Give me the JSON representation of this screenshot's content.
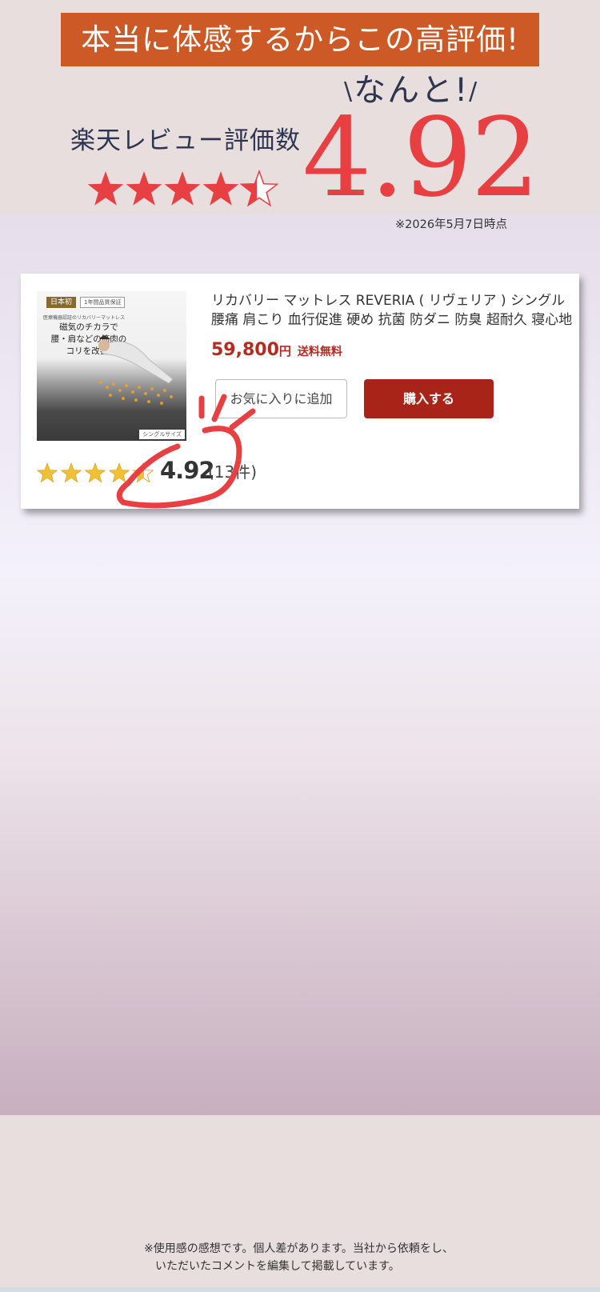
{
  "banner": {
    "text": "本当に体感するからこの高評価!"
  },
  "headline": {
    "exclaim": "なんと!",
    "review_label": "楽天レビュー評価数",
    "score": "4.92",
    "date_note": "※2026年5月7日時点"
  },
  "product": {
    "name_line1": "リカバリー マットレス REVERIA ( リヴェリア ) シングル",
    "name_line2": "腰痛 肩こり 血行促進 硬め 抗菌 防ダニ 防臭 超耐久 寝心地",
    "price": "59,800",
    "price_unit": "円",
    "shipping": "送料無料",
    "favorite_label": "お気に入りに追加",
    "buy_label": "購入する",
    "rating": 4.92,
    "rating_text": "4.92",
    "review_count": "(13件)",
    "image": {
      "badge": "日本初",
      "badge2": "1年間品質保証",
      "subcopy": "医療機器認証のリカバリーマットレス",
      "catch": "磁気のチカラで\n腰・肩などの筋肉の\nコリを改善!",
      "size_label": "シングルサイズ"
    }
  },
  "footer": {
    "disclaimer_line1": "※使用感の感想です。個人差があります。当社から依頼をし、",
    "disclaimer_line2": "　いただいたコメントを編集して掲載しています。"
  },
  "colors": {
    "banner": "#cd5a26",
    "score": "#e83f42",
    "price": "#b62a22",
    "buy_button": "#a82418",
    "stars_small": "#f3c033",
    "stars_big": "#e83f42"
  }
}
